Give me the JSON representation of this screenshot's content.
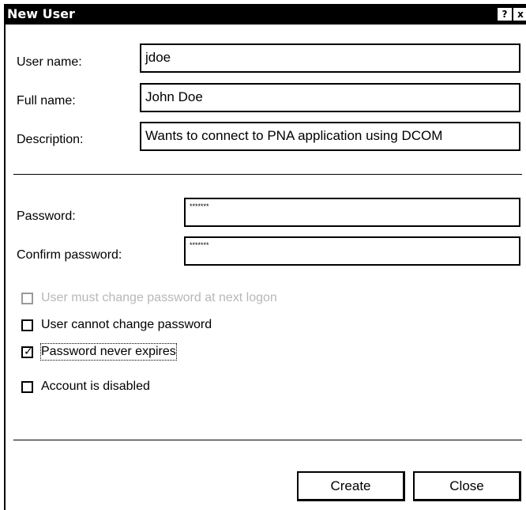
{
  "window": {
    "title": "New User",
    "help_label": "?",
    "close_label": "x"
  },
  "account": {
    "username_label": "User name:",
    "username_value": "jdoe",
    "fullname_label": "Full name:",
    "fullname_value": "John Doe",
    "description_label": "Description:",
    "description_value": "Wants to connect to PNA application using DCOM"
  },
  "password": {
    "password_label": "Password:",
    "password_value": "*******",
    "confirm_label": "Confirm password:",
    "confirm_value": "*******"
  },
  "options": [
    {
      "label": "User must change password at next logon",
      "checked": false,
      "enabled": false
    },
    {
      "label": "User cannot change password",
      "checked": false,
      "enabled": true
    },
    {
      "label": "Password never expires",
      "checked": true,
      "enabled": true
    },
    {
      "label": "Account is disabled",
      "checked": false,
      "enabled": true
    }
  ],
  "buttons": {
    "create_label": "Create",
    "close_label": "Close"
  }
}
